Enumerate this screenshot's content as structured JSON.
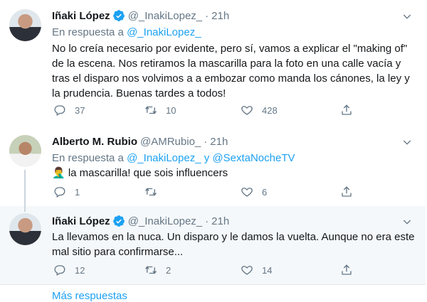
{
  "tweets": [
    {
      "name": "Iñaki López",
      "handle": "@_InakiLopez_",
      "dot": "·",
      "time": "21h",
      "reply_prefix": "En respuesta a",
      "reply_link1": "@_InakiLopez_",
      "reply_sep": "",
      "reply_link2": "",
      "text": "No lo creía necesario por evidente, pero sí, vamos a explicar el \"making of\" de la escena. Nos retiramos la mascarilla para la foto en una calle vacía y tras el disparo nos volvimos a a embozar como manda los cánones, la ley y la prudencia. Buenas tardes a todos!",
      "replies": "37",
      "retweets": "10",
      "likes": "428"
    },
    {
      "name": "Alberto M. Rubio",
      "handle": "@AMRubio_",
      "dot": "·",
      "time": "21h",
      "reply_prefix": "En respuesta a",
      "reply_link1": "@_InakiLopez_",
      "reply_sep": "y",
      "reply_link2": "@SextaNocheTV",
      "text": "🤦‍♂️ la mascarilla! que sois influencers",
      "replies": "1",
      "retweets": "",
      "likes": "6"
    },
    {
      "name": "Iñaki López",
      "handle": "@_InakiLopez_",
      "dot": "·",
      "time": "21h",
      "text": "La llevamos en la nuca. Un disparo y le damos la vuelta. Aunque no era este mal sitio para confirmarse...",
      "replies": "12",
      "retweets": "2",
      "likes": "14"
    }
  ],
  "more_replies": "Más respuestas",
  "colors": {
    "accent": "#1da1f2",
    "muted": "#657786",
    "hover_bg": "#f5f8fa"
  },
  "icons": [
    "verified-badge-icon",
    "caret-down-icon",
    "reply-icon",
    "retweet-icon",
    "like-icon",
    "share-icon"
  ]
}
